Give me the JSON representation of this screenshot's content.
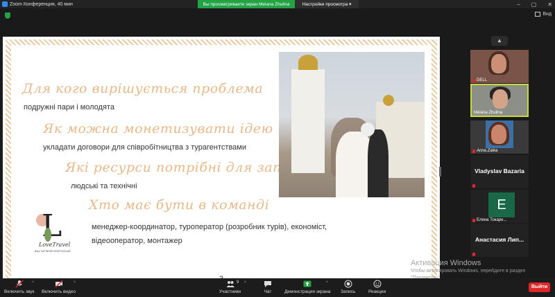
{
  "window": {
    "title": "Zoom Конференция, 40 мин",
    "controls": [
      "–",
      "▢",
      "✕"
    ]
  },
  "share_banner": {
    "text": "Вы просматриваете экран Melana Zhulina",
    "options_label": "Настройки просмотра ▾"
  },
  "view_button": {
    "label": "Вид"
  },
  "slide": {
    "sections": [
      {
        "heading": "Для кого вирішується проблема",
        "sub": "подружні пари і молодята"
      },
      {
        "heading": "Як можна монетизувати ідею",
        "sub": "укладати договори для співробітництва з турагентствами"
      },
      {
        "heading": "Які ресурси потрібні для запуску проекту",
        "sub": "людські та технічні"
      },
      {
        "heading": "Хто має бути в команді",
        "sub": "менеджер-координатор, туроператор (розробник турів), економіст, відеооператор, монтажер"
      }
    ],
    "page_number": "3",
    "logo": {
      "letter": "L",
      "brand": "LoveTravel",
      "tagline": "ВАШ ЧАРІВНИЙ КРАЙ ЕМОЦІЙ"
    }
  },
  "gallery": {
    "participants": [
      {
        "name": "DELL",
        "type": "video"
      },
      {
        "name": "Melana Zhulina",
        "type": "video",
        "active": true
      },
      {
        "name": "Anna Zaika",
        "type": "video"
      },
      {
        "name": "Vladyslav Bazaria",
        "type": "name"
      },
      {
        "name": "Елена Токаре...",
        "type": "initial",
        "initial": "E"
      },
      {
        "name": "Анастасия Лип...",
        "type": "name"
      }
    ]
  },
  "activation": {
    "title": "Активация Windows",
    "line1": "Чтобы активировать Windows, перейдите в раздел",
    "line2": "\"Параметры\"."
  },
  "toolbar": {
    "audio": "Включить звук",
    "video": "Включить видео",
    "participants": "Участники",
    "participants_count": "9",
    "chat": "Чат",
    "share": "Демонстрация экрана",
    "record": "Запись",
    "reactions": "Реакции",
    "leave": "Выйти"
  },
  "colors": {
    "share_green": "#23a343",
    "leave_red": "#e02828",
    "active_border": "#c7da3c",
    "heading_peach": "#e8b98a"
  }
}
